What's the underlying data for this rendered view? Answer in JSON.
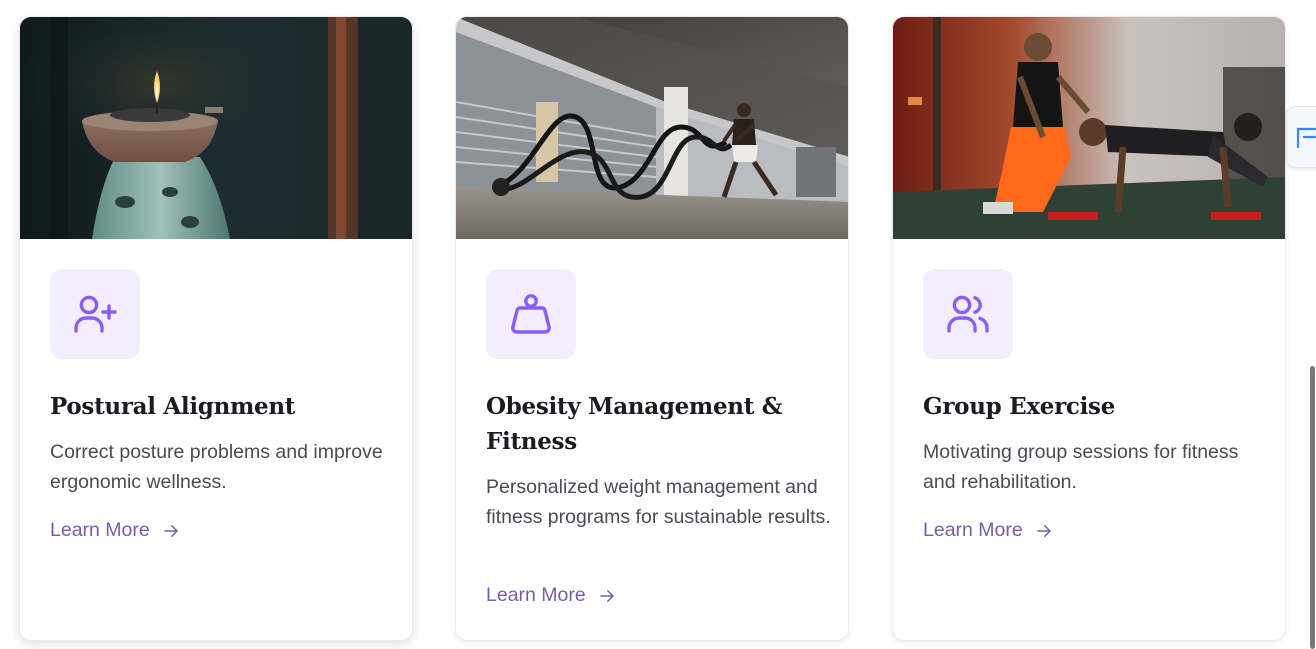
{
  "colors": {
    "accent": "#7b5ca8",
    "icon_stroke": "#8b5cf6",
    "icon_bg": "#f3eeff",
    "title": "#1c1b22",
    "body_text": "#4b4a55"
  },
  "cards": [
    {
      "image": "candle-photo",
      "icon": "user-plus-icon",
      "title": "Postural Alignment",
      "description": "Correct posture problems and improve ergonomic wellness.",
      "link_label": "Learn More"
    },
    {
      "image": "battle-rope-photo",
      "icon": "weight-icon",
      "title": "Obesity Management & Fitness",
      "description": "Personalized weight management and fitness programs for sustainable results.",
      "link_label": "Learn More"
    },
    {
      "image": "trainer-pushup-photo",
      "icon": "users-icon",
      "title": "Group Exercise",
      "description": "Motivating group sessions for fitness and rehabilitation.",
      "link_label": "Learn More"
    }
  ]
}
